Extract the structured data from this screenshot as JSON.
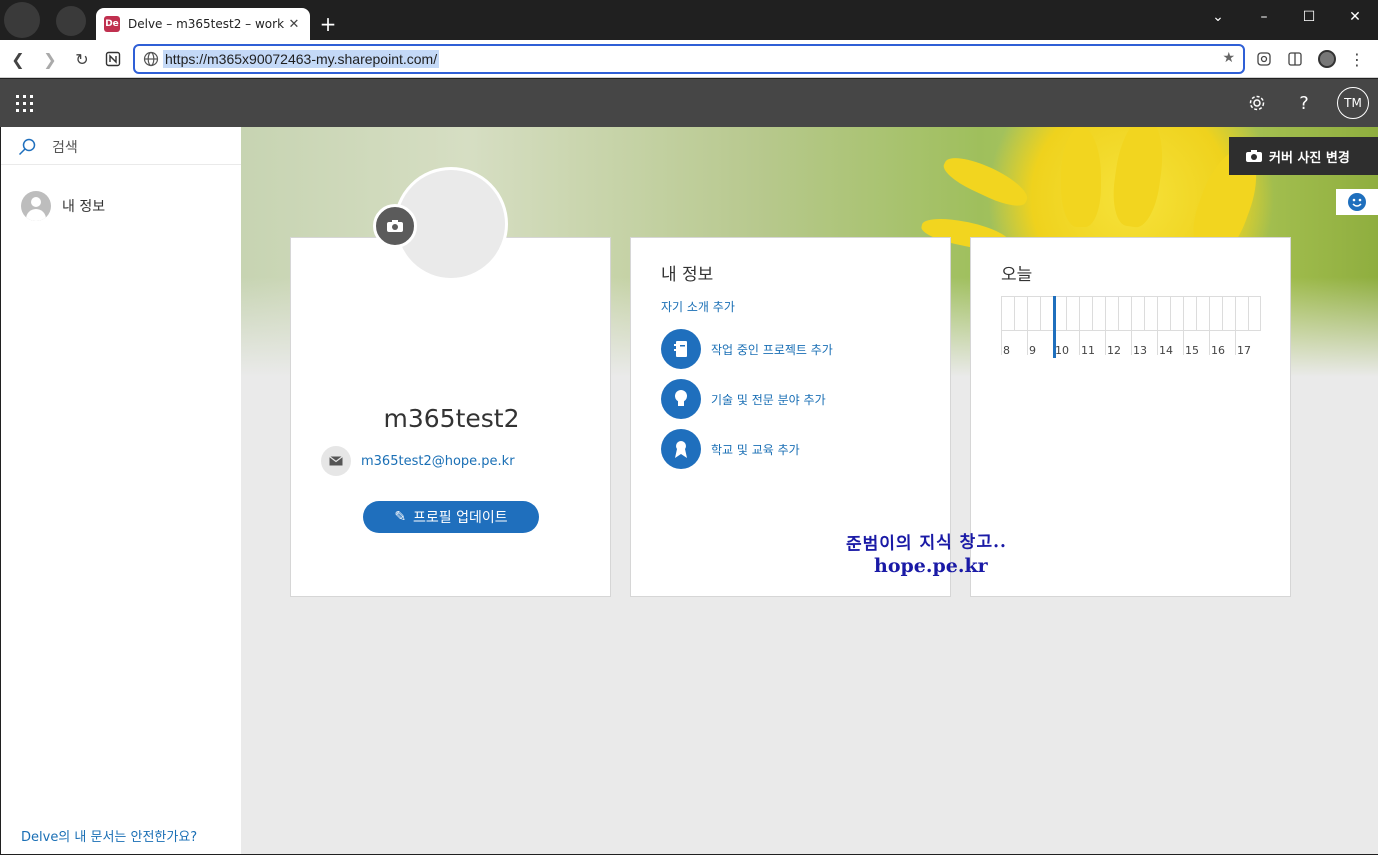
{
  "browser": {
    "tab_title": "Delve – m365test2 – work",
    "tab_favicon": "De",
    "new_tab": "+",
    "url": "https://m365x90072463-my.sharepoint.com/"
  },
  "suite": {
    "avatar_initials": "TM",
    "help": "?"
  },
  "nav": {
    "search_label": "검색",
    "me_label": "내 정보",
    "safe_link": "Delve의 내 문서는 안전한가요?"
  },
  "cover": {
    "change_button": "커버 사진 변경"
  },
  "profile": {
    "name": "m365test2",
    "email": "m365test2@hope.pe.kr",
    "update_button": "프로필 업데이트"
  },
  "about": {
    "title": "내 정보",
    "intro_link": "자기 소개 추가",
    "items": [
      {
        "label": "작업 중인 프로젝트 추가",
        "icon": "notebook-icon"
      },
      {
        "label": "기술 및 전문 분야 추가",
        "icon": "lightbulb-icon"
      },
      {
        "label": "학교 및 교육 추가",
        "icon": "ribbon-icon"
      }
    ]
  },
  "today": {
    "title": "오늘",
    "hours": [
      "8",
      "9",
      "10",
      "11",
      "12",
      "13",
      "14",
      "15",
      "16",
      "17"
    ]
  },
  "watermark": {
    "line1": "준범이의 지식 창고..",
    "line2": "hope.pe.kr"
  },
  "colors": {
    "accent": "#1f6fbd",
    "suitebar": "#464646",
    "link": "#1a6fb5"
  }
}
